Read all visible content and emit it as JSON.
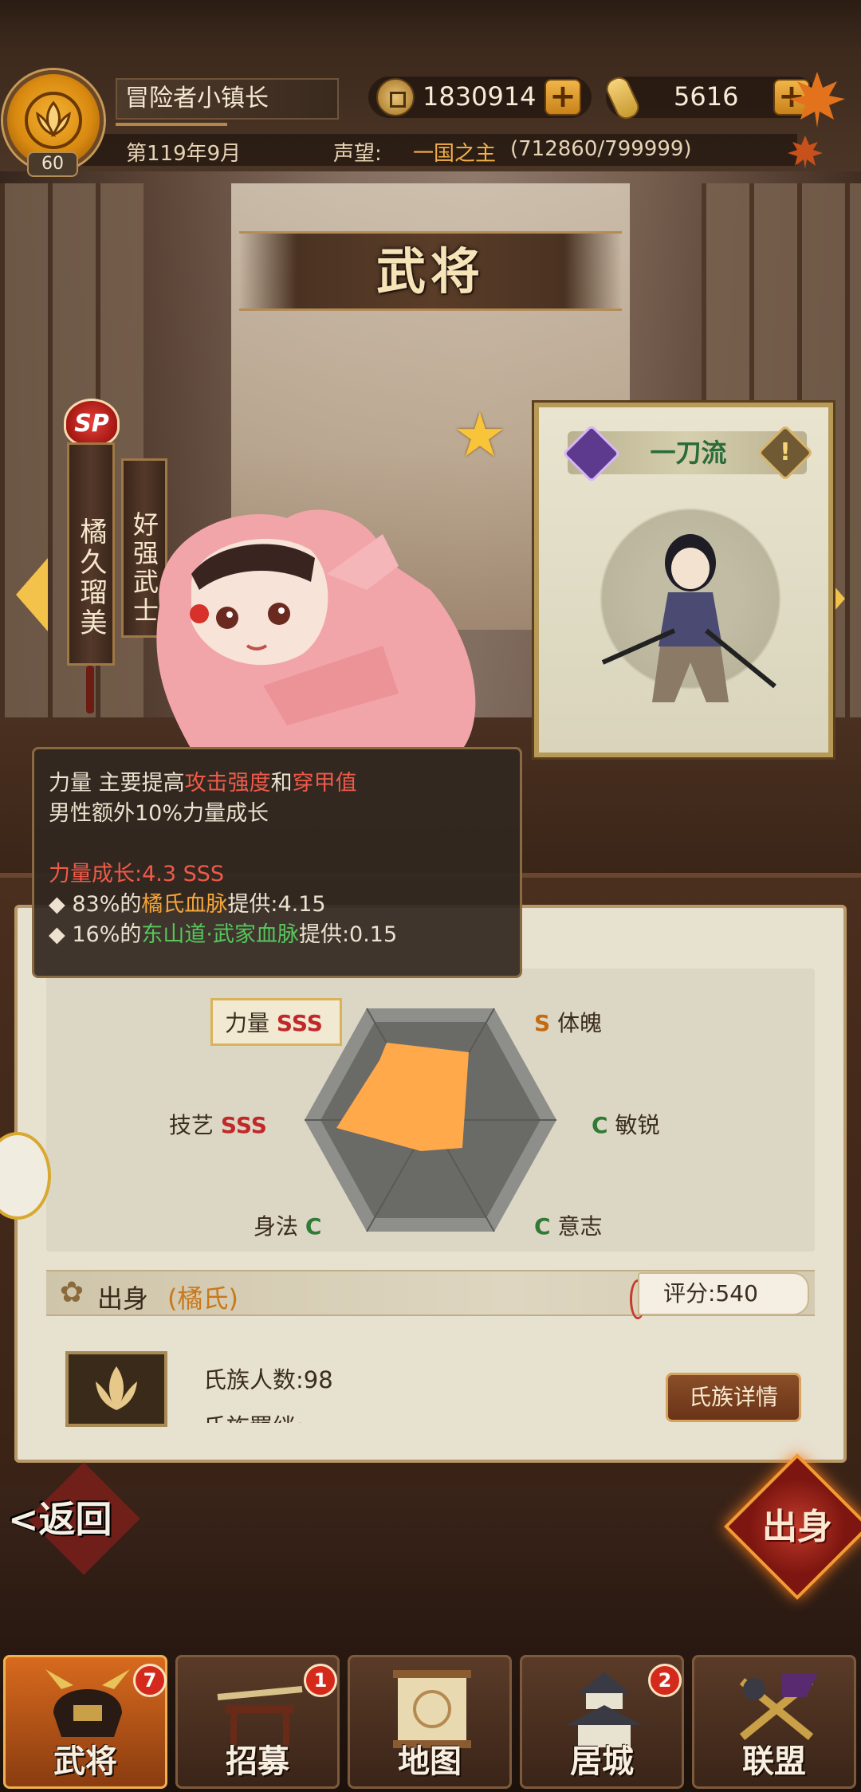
{
  "header": {
    "player_name": "冒险者小镇长",
    "level": "60",
    "date": "第119年9月",
    "reputation_label": "声望:",
    "reputation_value": "一国之主",
    "reputation_progress": "(712860/799999)",
    "coins": "1830914",
    "gold": "5616",
    "plus_symbol": "+"
  },
  "page_title": "武将",
  "character": {
    "rarity_badge": "SP",
    "name": "橘久瑠美",
    "title": "好强武士",
    "star_icon": "★"
  },
  "skill_card": {
    "name": "一刀流",
    "info_symbol": "!"
  },
  "tooltip": {
    "line1_prefix": "力量  主要提高",
    "line1_red1": "攻击强度",
    "line1_mid": "和",
    "line1_red2": "穿甲值",
    "line2": "男性额外10%力量成长",
    "growth_label": "力量成长",
    "growth_value": ":4.3 SSS",
    "src1_prefix": "◆ 83%的",
    "src1_clan": "橘氏血脉",
    "src1_suffix": "提供:4.15",
    "src2_prefix": "◆ 16%的",
    "src2_clan": "东山道·武家血脉",
    "src2_suffix": "提供:0.15"
  },
  "stats": [
    {
      "label": "力量",
      "grade": "SSS"
    },
    {
      "label": "体魄",
      "grade": "S"
    },
    {
      "label": "敏锐",
      "grade": "C"
    },
    {
      "label": "意志",
      "grade": "C"
    },
    {
      "label": "身法",
      "grade": "C"
    },
    {
      "label": "技艺",
      "grade": "SSS"
    }
  ],
  "origin": {
    "title": "出身",
    "clan": "(橘氏)",
    "score": "评分:540",
    "clan_count": "氏族人数:98",
    "clan_next": "氏族羁绊:",
    "detail_button": "氏族详情"
  },
  "footer": {
    "back": "<返回",
    "chushen": "出身"
  },
  "tabs": [
    {
      "label": "武将",
      "badge": "7"
    },
    {
      "label": "招募",
      "badge": "1"
    },
    {
      "label": "地图",
      "badge": ""
    },
    {
      "label": "居城",
      "badge": "2"
    },
    {
      "label": "联盟",
      "badge": ""
    }
  ],
  "colors": {
    "accent_gold": "#f3c24a",
    "grade_sss": "#c0282a",
    "grade_s": "#c46b12",
    "grade_c": "#2f7a35",
    "radar_fill": "#ffa94a",
    "tab_active": "#d86a1e"
  },
  "icons": {
    "avatar": "clan-crest-icon",
    "coin": "coin-icon",
    "gold": "gold-ingot-icon",
    "nav_prev": "chevron-left-icon",
    "nav_next": "chevron-right-icon",
    "skill_type": "sword-skill-icon",
    "origin": "flower-crest-icon"
  }
}
